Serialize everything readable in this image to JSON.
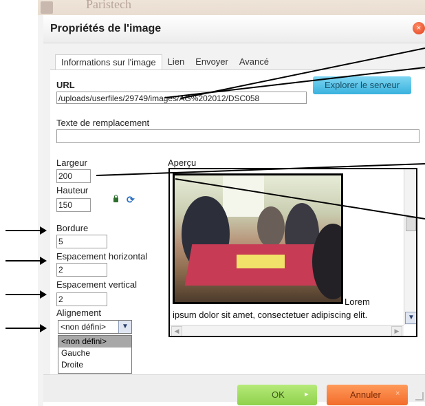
{
  "background": {
    "logo_text": "Paristech"
  },
  "dialog": {
    "title": "Propriétés de l'image",
    "close_symbol": "×"
  },
  "tabs": [
    {
      "label": "Informations sur l'image",
      "active": true
    },
    {
      "label": "Lien",
      "active": false
    },
    {
      "label": "Envoyer",
      "active": false
    },
    {
      "label": "Avancé",
      "active": false
    }
  ],
  "form": {
    "url_label": "URL",
    "url_value": "/uploads/userfiles/29749/images/AG%202012/DSC058",
    "browse_label": "Explorer le serveur",
    "alt_label": "Texte de remplacement",
    "alt_value": "",
    "width_label": "Largeur",
    "width_value": "200",
    "height_label": "Hauteur",
    "height_value": "150",
    "border_label": "Bordure",
    "border_value": "5",
    "hspace_label": "Espacement horizontal",
    "hspace_value": "2",
    "vspace_label": "Espacement vertical",
    "vspace_value": "2",
    "align_label": "Alignement",
    "align_value": "<non défini>",
    "align_options": [
      "<non défini>",
      "Gauche",
      "Droite"
    ]
  },
  "preview": {
    "label": "Aperçu",
    "lorem_inline": "Lorem",
    "lorem_line": "ipsum dolor sit amet, consectetuer adipiscing elit."
  },
  "footer": {
    "ok_label": "OK",
    "cancel_label": "Annuler",
    "cancel_mark": "×",
    "ok_mark": "▸"
  },
  "icons": [
    "lock-icon",
    "reset-size-icon",
    "close-icon",
    "arrow-right-icon",
    "chevron-down-icon",
    "resize-grip-icon"
  ],
  "colors": {
    "ok": "#8fd14c",
    "cancel": "#f26c2a",
    "browse": "#39b2de",
    "close": "#e0401a"
  }
}
